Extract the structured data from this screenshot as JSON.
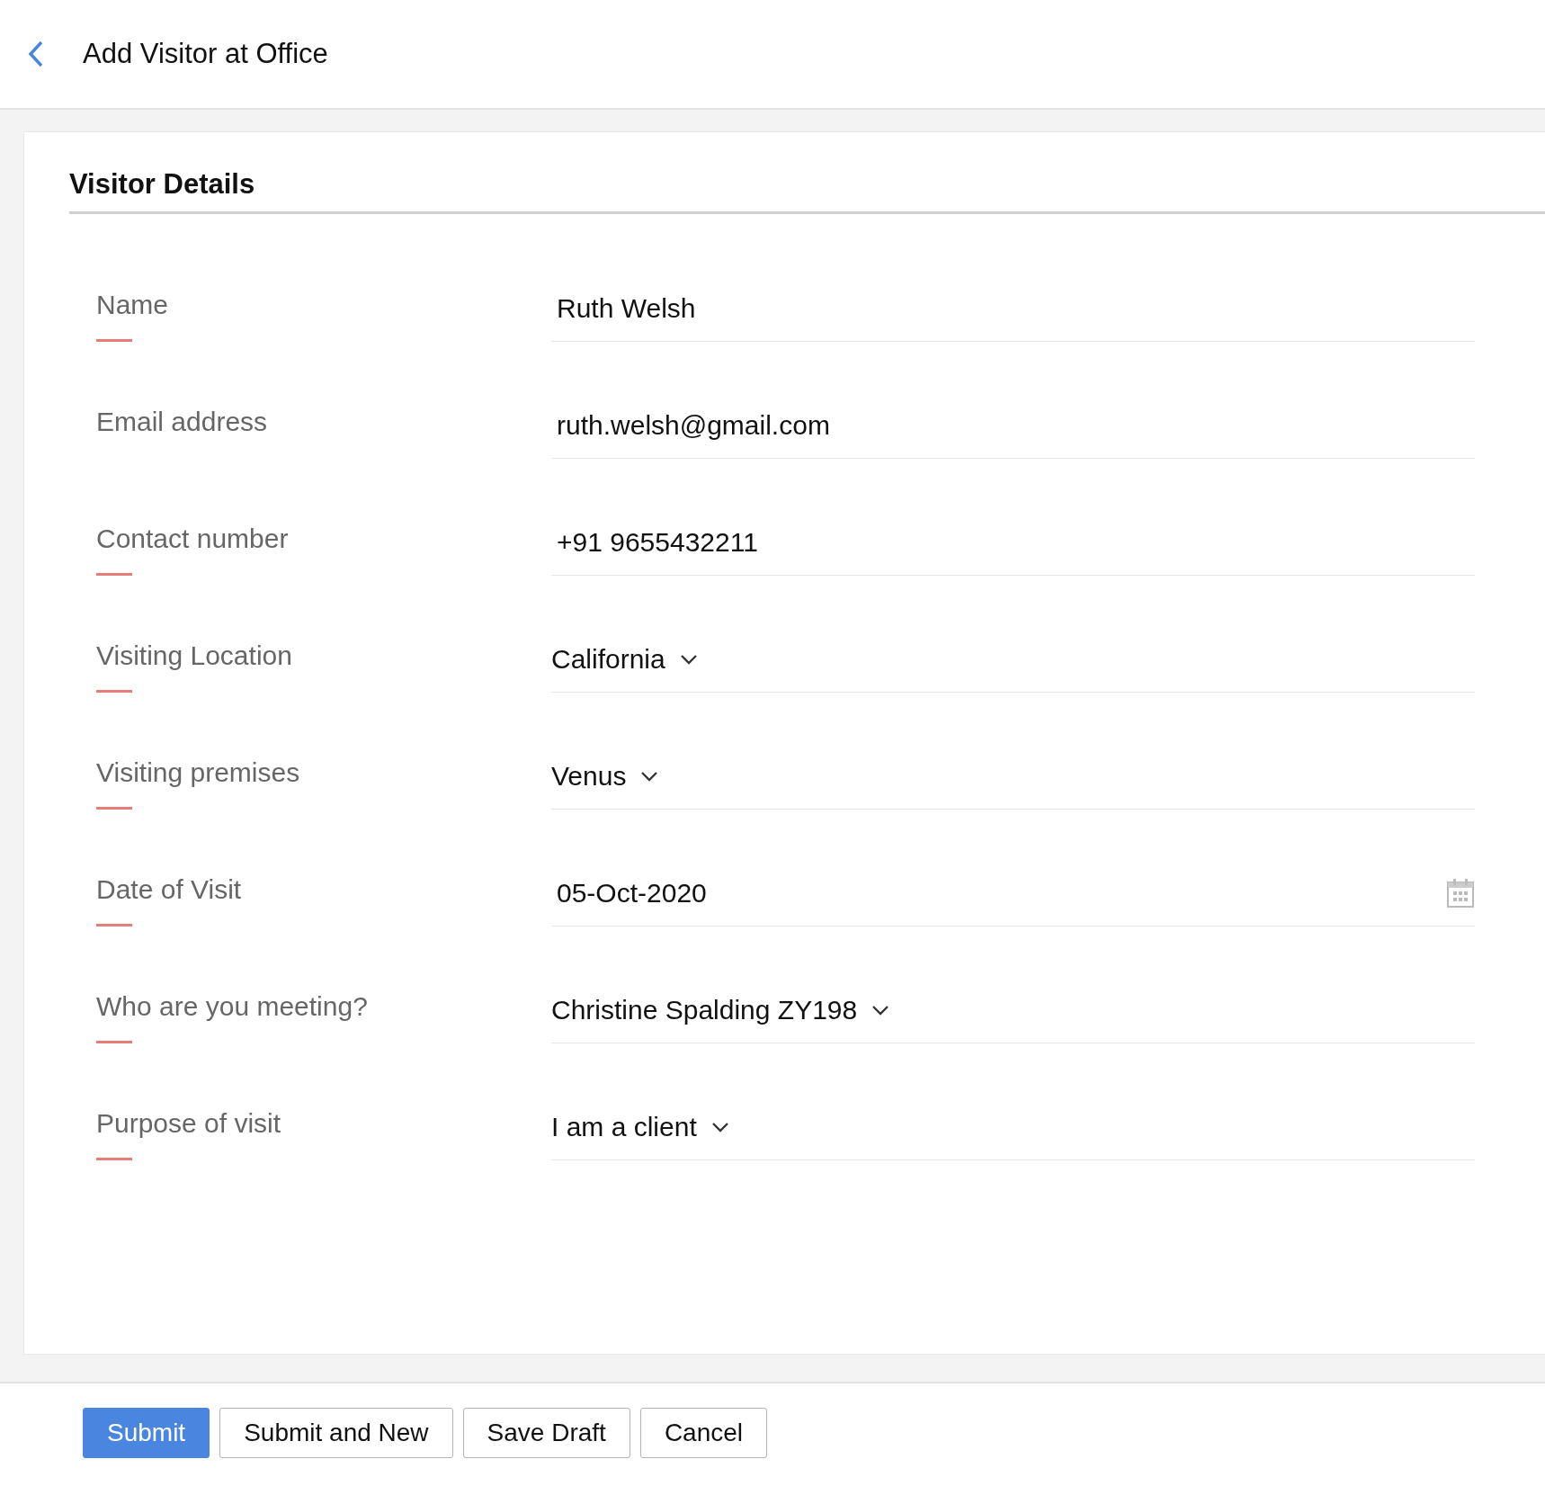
{
  "header": {
    "title": "Add Visitor at Office"
  },
  "section": {
    "title": "Visitor Details"
  },
  "fields": [
    {
      "label": "Name",
      "kind": "text",
      "value": "Ruth Welsh",
      "required": true
    },
    {
      "label": "Email address",
      "kind": "text",
      "value": "ruth.welsh@gmail.com",
      "required": false
    },
    {
      "label": "Contact number",
      "kind": "text",
      "value": "+91 9655432211",
      "required": true
    },
    {
      "label": "Visiting Location",
      "kind": "dropdown",
      "value": "California",
      "required": true
    },
    {
      "label": "Visiting premises",
      "kind": "dropdown",
      "value": "Venus",
      "required": true
    },
    {
      "label": "Date of Visit",
      "kind": "date",
      "value": "05-Oct-2020",
      "required": true
    },
    {
      "label": "Who are you meeting?",
      "kind": "dropdown",
      "value": "Christine Spalding ZY198",
      "required": true
    },
    {
      "label": "Purpose of visit",
      "kind": "dropdown",
      "value": "I am a client",
      "required": true
    }
  ],
  "buttons": [
    {
      "label": "Submit",
      "kind": "primary"
    },
    {
      "label": "Submit and New",
      "kind": "secondary"
    },
    {
      "label": "Save Draft",
      "kind": "secondary"
    },
    {
      "label": "Cancel",
      "kind": "secondary"
    }
  ]
}
